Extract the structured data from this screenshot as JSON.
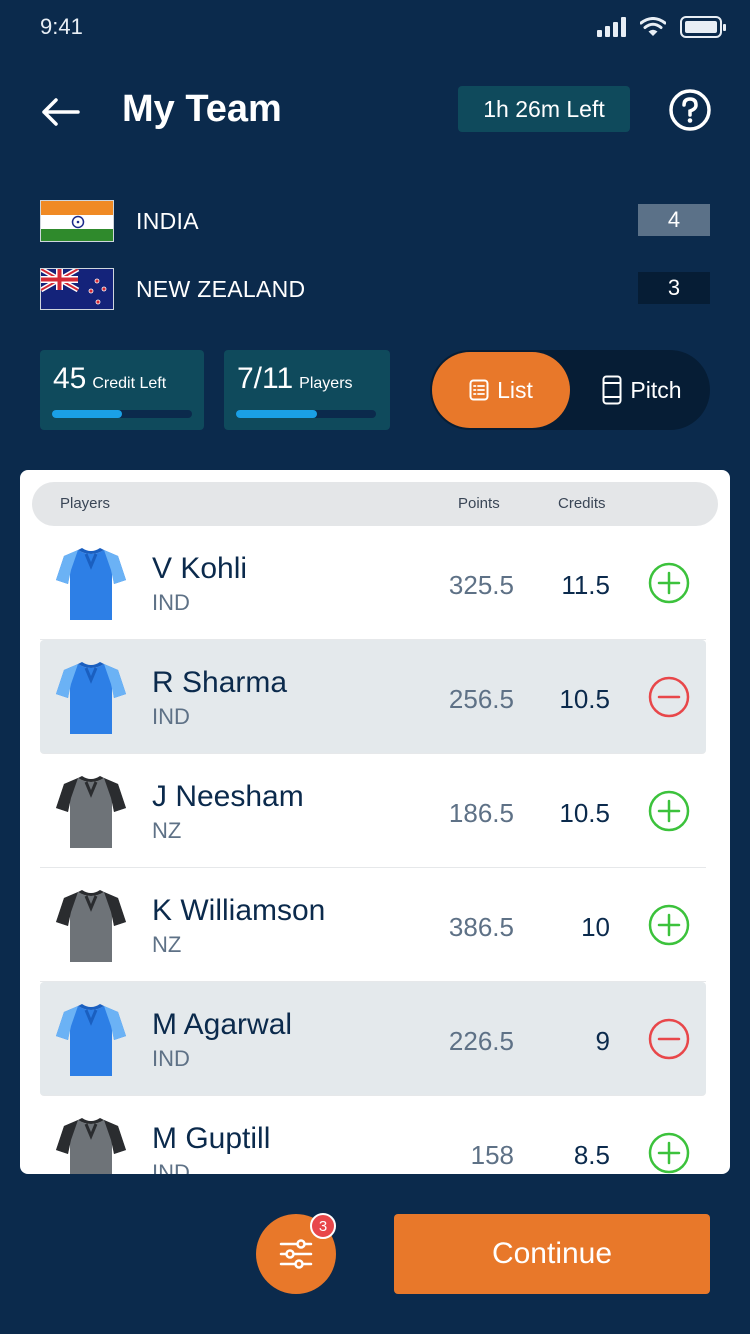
{
  "status_bar": {
    "time": "9:41"
  },
  "header": {
    "title": "My Team",
    "time_left": "1h 26m Left"
  },
  "teams": [
    {
      "name": "INDIA",
      "count": "4",
      "flag_icon": "india-flag-icon"
    },
    {
      "name": "NEW ZEALAND",
      "count": "3",
      "flag_icon": "new-zealand-flag-icon"
    }
  ],
  "stats": {
    "credit_value": "45",
    "credit_label": "Credit Left",
    "credit_progress": 0.5,
    "players_value": "7/11",
    "players_label": "Players",
    "players_progress": 0.58
  },
  "view_toggle": {
    "list_label": "List",
    "pitch_label": "Pitch",
    "active": "List"
  },
  "table": {
    "col_players": "Players",
    "col_points": "Points",
    "col_credits": "Credits",
    "rows": [
      {
        "name": "V Kohli",
        "team": "IND",
        "points": "325.5",
        "credits": "11.5",
        "selected": false,
        "jersey": "blue"
      },
      {
        "name": "R Sharma",
        "team": "IND",
        "points": "256.5",
        "credits": "10.5",
        "selected": true,
        "jersey": "blue"
      },
      {
        "name": "J Neesham",
        "team": "NZ",
        "points": "186.5",
        "credits": "10.5",
        "selected": false,
        "jersey": "gray"
      },
      {
        "name": "K Williamson",
        "team": "NZ",
        "points": "386.5",
        "credits": "10",
        "selected": false,
        "jersey": "gray"
      },
      {
        "name": "M Agarwal",
        "team": "IND",
        "points": "226.5",
        "credits": "9",
        "selected": true,
        "jersey": "blue"
      },
      {
        "name": "M Guptill",
        "team": "IND",
        "points": "158",
        "credits": "8.5",
        "selected": false,
        "jersey": "gray"
      }
    ]
  },
  "footer": {
    "filter_badge": "3",
    "continue_label": "Continue"
  },
  "colors": {
    "background": "#0b2a4c",
    "accent": "#e8782a",
    "add": "#3cc23c",
    "remove": "#e8474a"
  }
}
